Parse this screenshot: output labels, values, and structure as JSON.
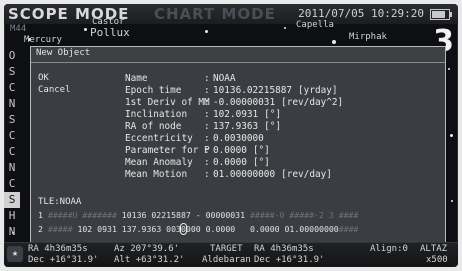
{
  "header": {
    "mode_scope": "SCOPE MODE",
    "mode_chart": "CHART MODE",
    "datetime": "2011/07/05 10:29:20",
    "battery_level": 0.8
  },
  "sky": {
    "labels": [
      "Castor",
      "Pollux",
      "Mercury",
      "Capella",
      "Mirphak",
      "M44"
    ],
    "page_number": "3"
  },
  "left_menu": [
    "O",
    "S",
    "C",
    "N",
    "S",
    "C",
    "C",
    "N",
    "C",
    "S",
    "H",
    "N"
  ],
  "dialog": {
    "title": "New Object",
    "options": [
      "OK",
      "Cancel"
    ],
    "params": [
      {
        "name": "Name",
        "value": "NOAA",
        "unit": ""
      },
      {
        "name": "Epoch time",
        "value": "10136.02215887",
        "unit": "[yrday]"
      },
      {
        "name": "1st Deriv of MM",
        "value": "-0.00000031",
        "unit": "[rev/day^2]"
      },
      {
        "name": "Inclination",
        "value": "102.0931",
        "unit": "[°]"
      },
      {
        "name": "RA of node",
        "value": "137.9363",
        "unit": "[°]"
      },
      {
        "name": "Eccentricity",
        "value": "0.0030000",
        "unit": ""
      },
      {
        "name": "Parameter for P",
        "value": "0.0000",
        "unit": "[°]"
      },
      {
        "name": "Mean Anomaly",
        "value": "0.0000",
        "unit": "[°]"
      },
      {
        "name": "Mean Motion",
        "value": "01.00000000",
        "unit": "[rev/day]"
      }
    ],
    "tle_name": "TLE:NOAA",
    "tle_line1": {
      "prefix": "1 ",
      "dim1": "#####U #######",
      "main": " 10136 02215887 - 00000031 ",
      "dim2": "#####-0 #####-2 3 ####"
    },
    "tle_line2": {
      "prefix": "2 ",
      "dim1": "#####",
      "main_a": " 102 0931 137.9363 003",
      "hi": "0",
      "main_b": "000 0.0000 ",
      "main_c": "  0.0000 01.00000000",
      "dim2": "####"
    }
  },
  "status": {
    "ra_label": "RA",
    "ra_value": "4h36m35s",
    "az_label": "Az",
    "az_value": "207°39.6'",
    "dec_label": "Dec",
    "dec_value": "+16°31.9'",
    "alt_label": "Alt",
    "alt_value": "+63°31.2'",
    "target_label": "TARGET",
    "target_ra_label": "RA",
    "target_ra": "4h36m35s",
    "target_name": "Aldebaran",
    "target_dec_label": "Dec",
    "target_dec": "+16°31.9'",
    "align": "Align:0",
    "mount": "ALTAZ",
    "zoom": "x500"
  }
}
